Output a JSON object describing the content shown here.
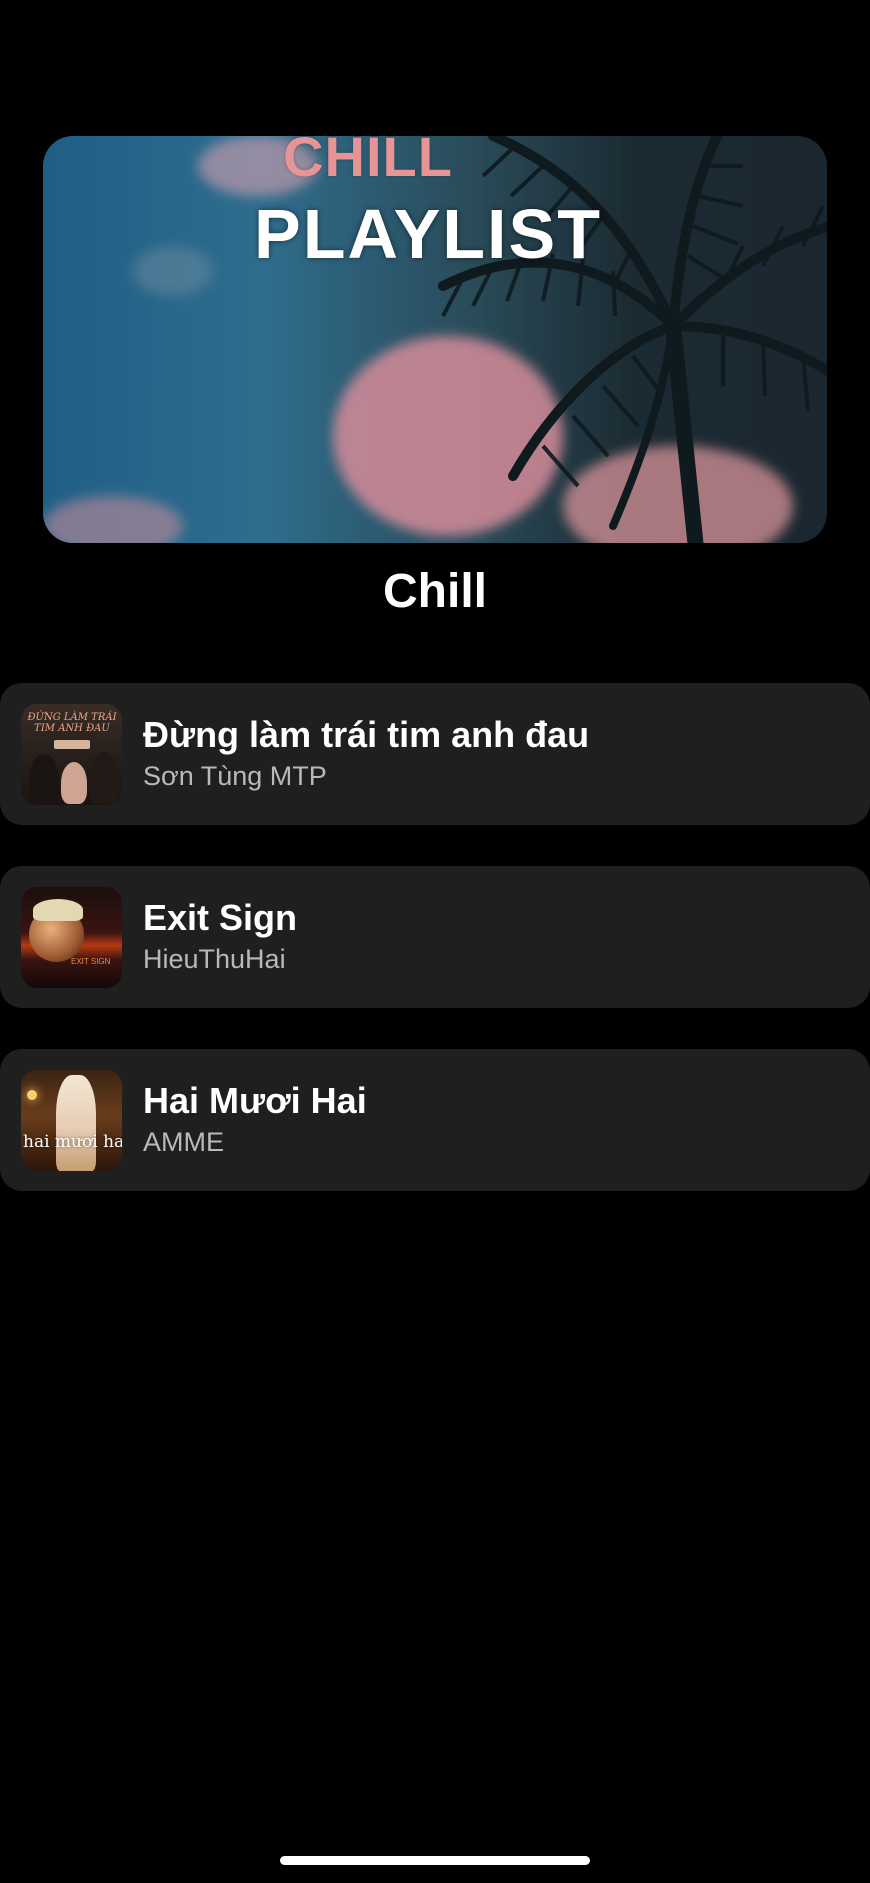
{
  "cover": {
    "line1": "CHILL",
    "line2": "PLAYLIST",
    "colors": {
      "sky": "#1f5f86",
      "cloud": "#e69596",
      "palm": "#0f1a1f"
    }
  },
  "playlist": {
    "title": "Chill"
  },
  "tracks": [
    {
      "title": "Đừng làm trái tim anh đau",
      "artist": "Sơn Tùng MTP",
      "art_text": "ĐỪNG LÀM TRÁI TIM ANH ĐAU"
    },
    {
      "title": "Exit Sign",
      "artist": "HieuThuHai",
      "art_text": "EXIT SIGN"
    },
    {
      "title": "Hai Mươi Hai",
      "artist": "AMME",
      "art_text": "hai mươi hai"
    }
  ],
  "colors": {
    "background": "#000000",
    "row_background": "#1f1f1f",
    "primary_text": "#ffffff",
    "secondary_text": "#b9b9bb"
  }
}
